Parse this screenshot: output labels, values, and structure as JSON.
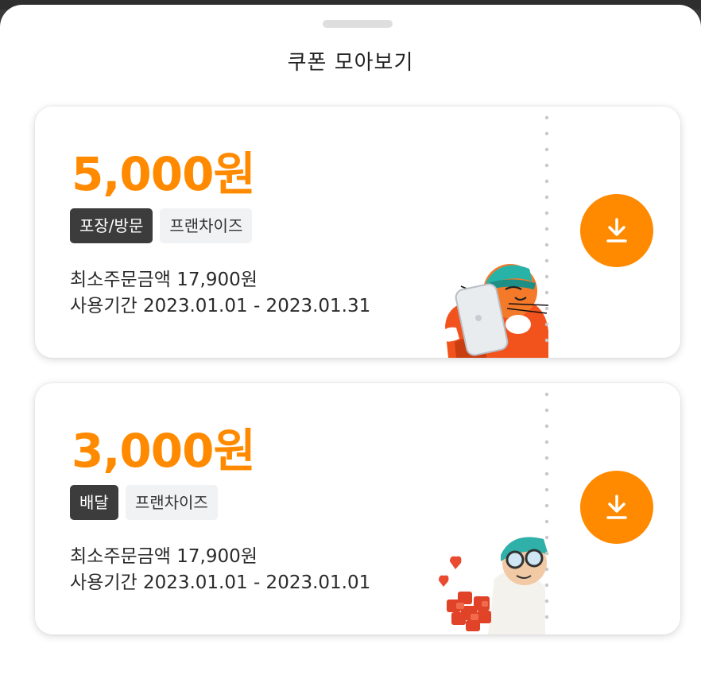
{
  "sheet": {
    "title": "쿠폰 모아보기"
  },
  "coupons": [
    {
      "amount": "5,000원",
      "tags": [
        "포장/방문",
        "프랜차이즈"
      ],
      "min_order": "최소주문금액 17,900원",
      "period": "사용기간 2023.01.01 - 2023.01.31",
      "download_icon": "download-icon"
    },
    {
      "amount": "3,000원",
      "tags": [
        "배달",
        "프랜차이즈"
      ],
      "min_order": "최소주문금액 17,900원",
      "period": "사용기간 2023.01.01 - 2023.01.01",
      "download_icon": "download-icon"
    }
  ],
  "colors": {
    "accent": "#ff8a00",
    "tag_dark": "#3c3c3c",
    "tag_light": "#f1f2f4"
  }
}
